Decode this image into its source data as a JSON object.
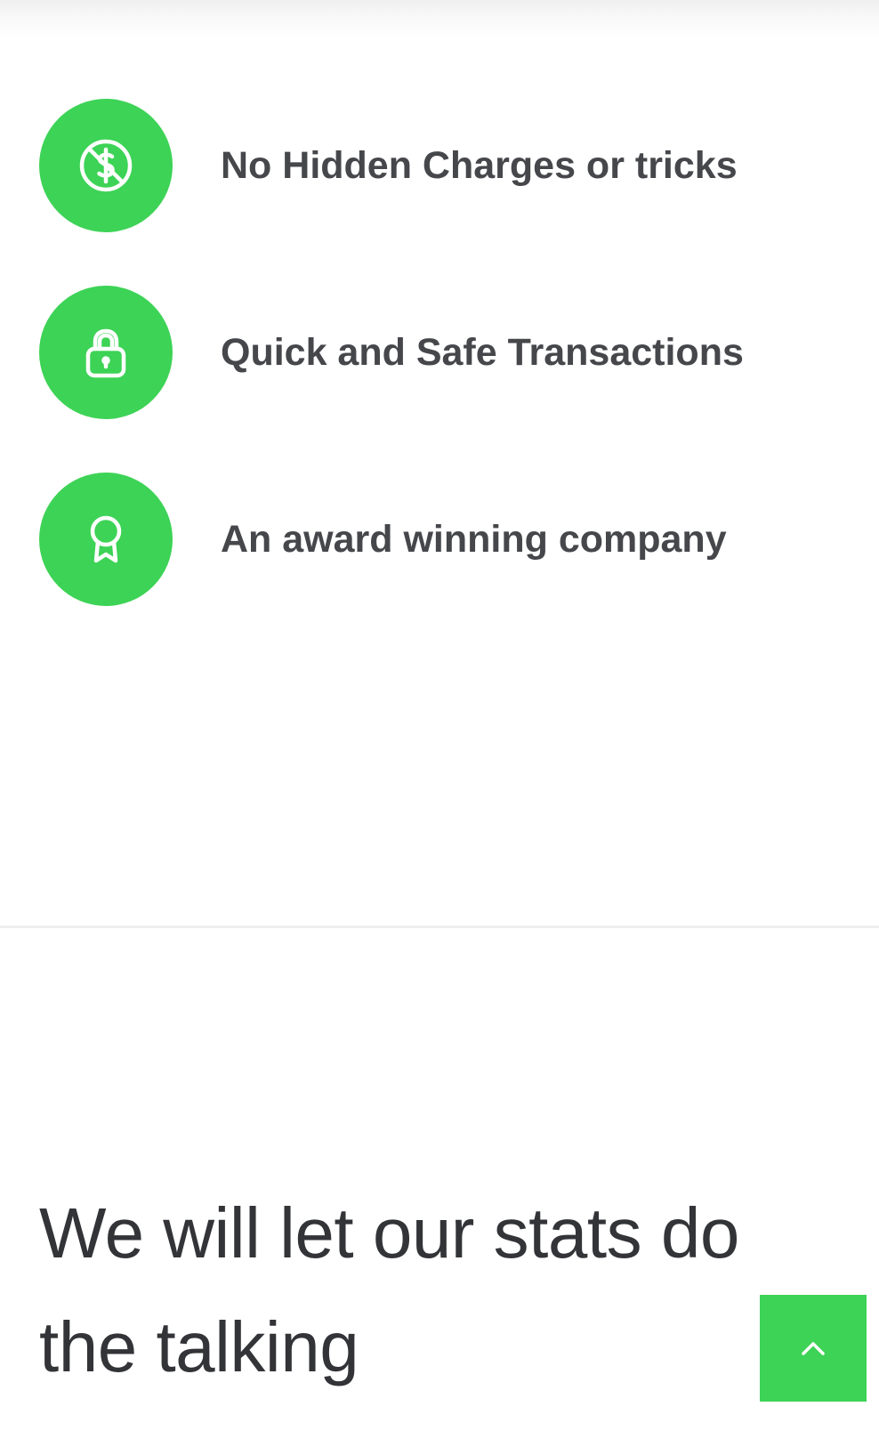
{
  "features": [
    {
      "icon": "no-dollar-icon",
      "label": "No Hidden Charges or tricks"
    },
    {
      "icon": "lock-icon",
      "label": "Quick and Safe Transactions"
    },
    {
      "icon": "award-ribbon-icon",
      "label": "An award winning company"
    }
  ],
  "stats": {
    "heading": "We will let our stats do the talking"
  },
  "back_to_top": {
    "icon": "chevron-up-icon"
  },
  "colors": {
    "accent": "#3dd356",
    "text": "#45474b",
    "heading": "#333438",
    "divider": "#eeeeee"
  }
}
